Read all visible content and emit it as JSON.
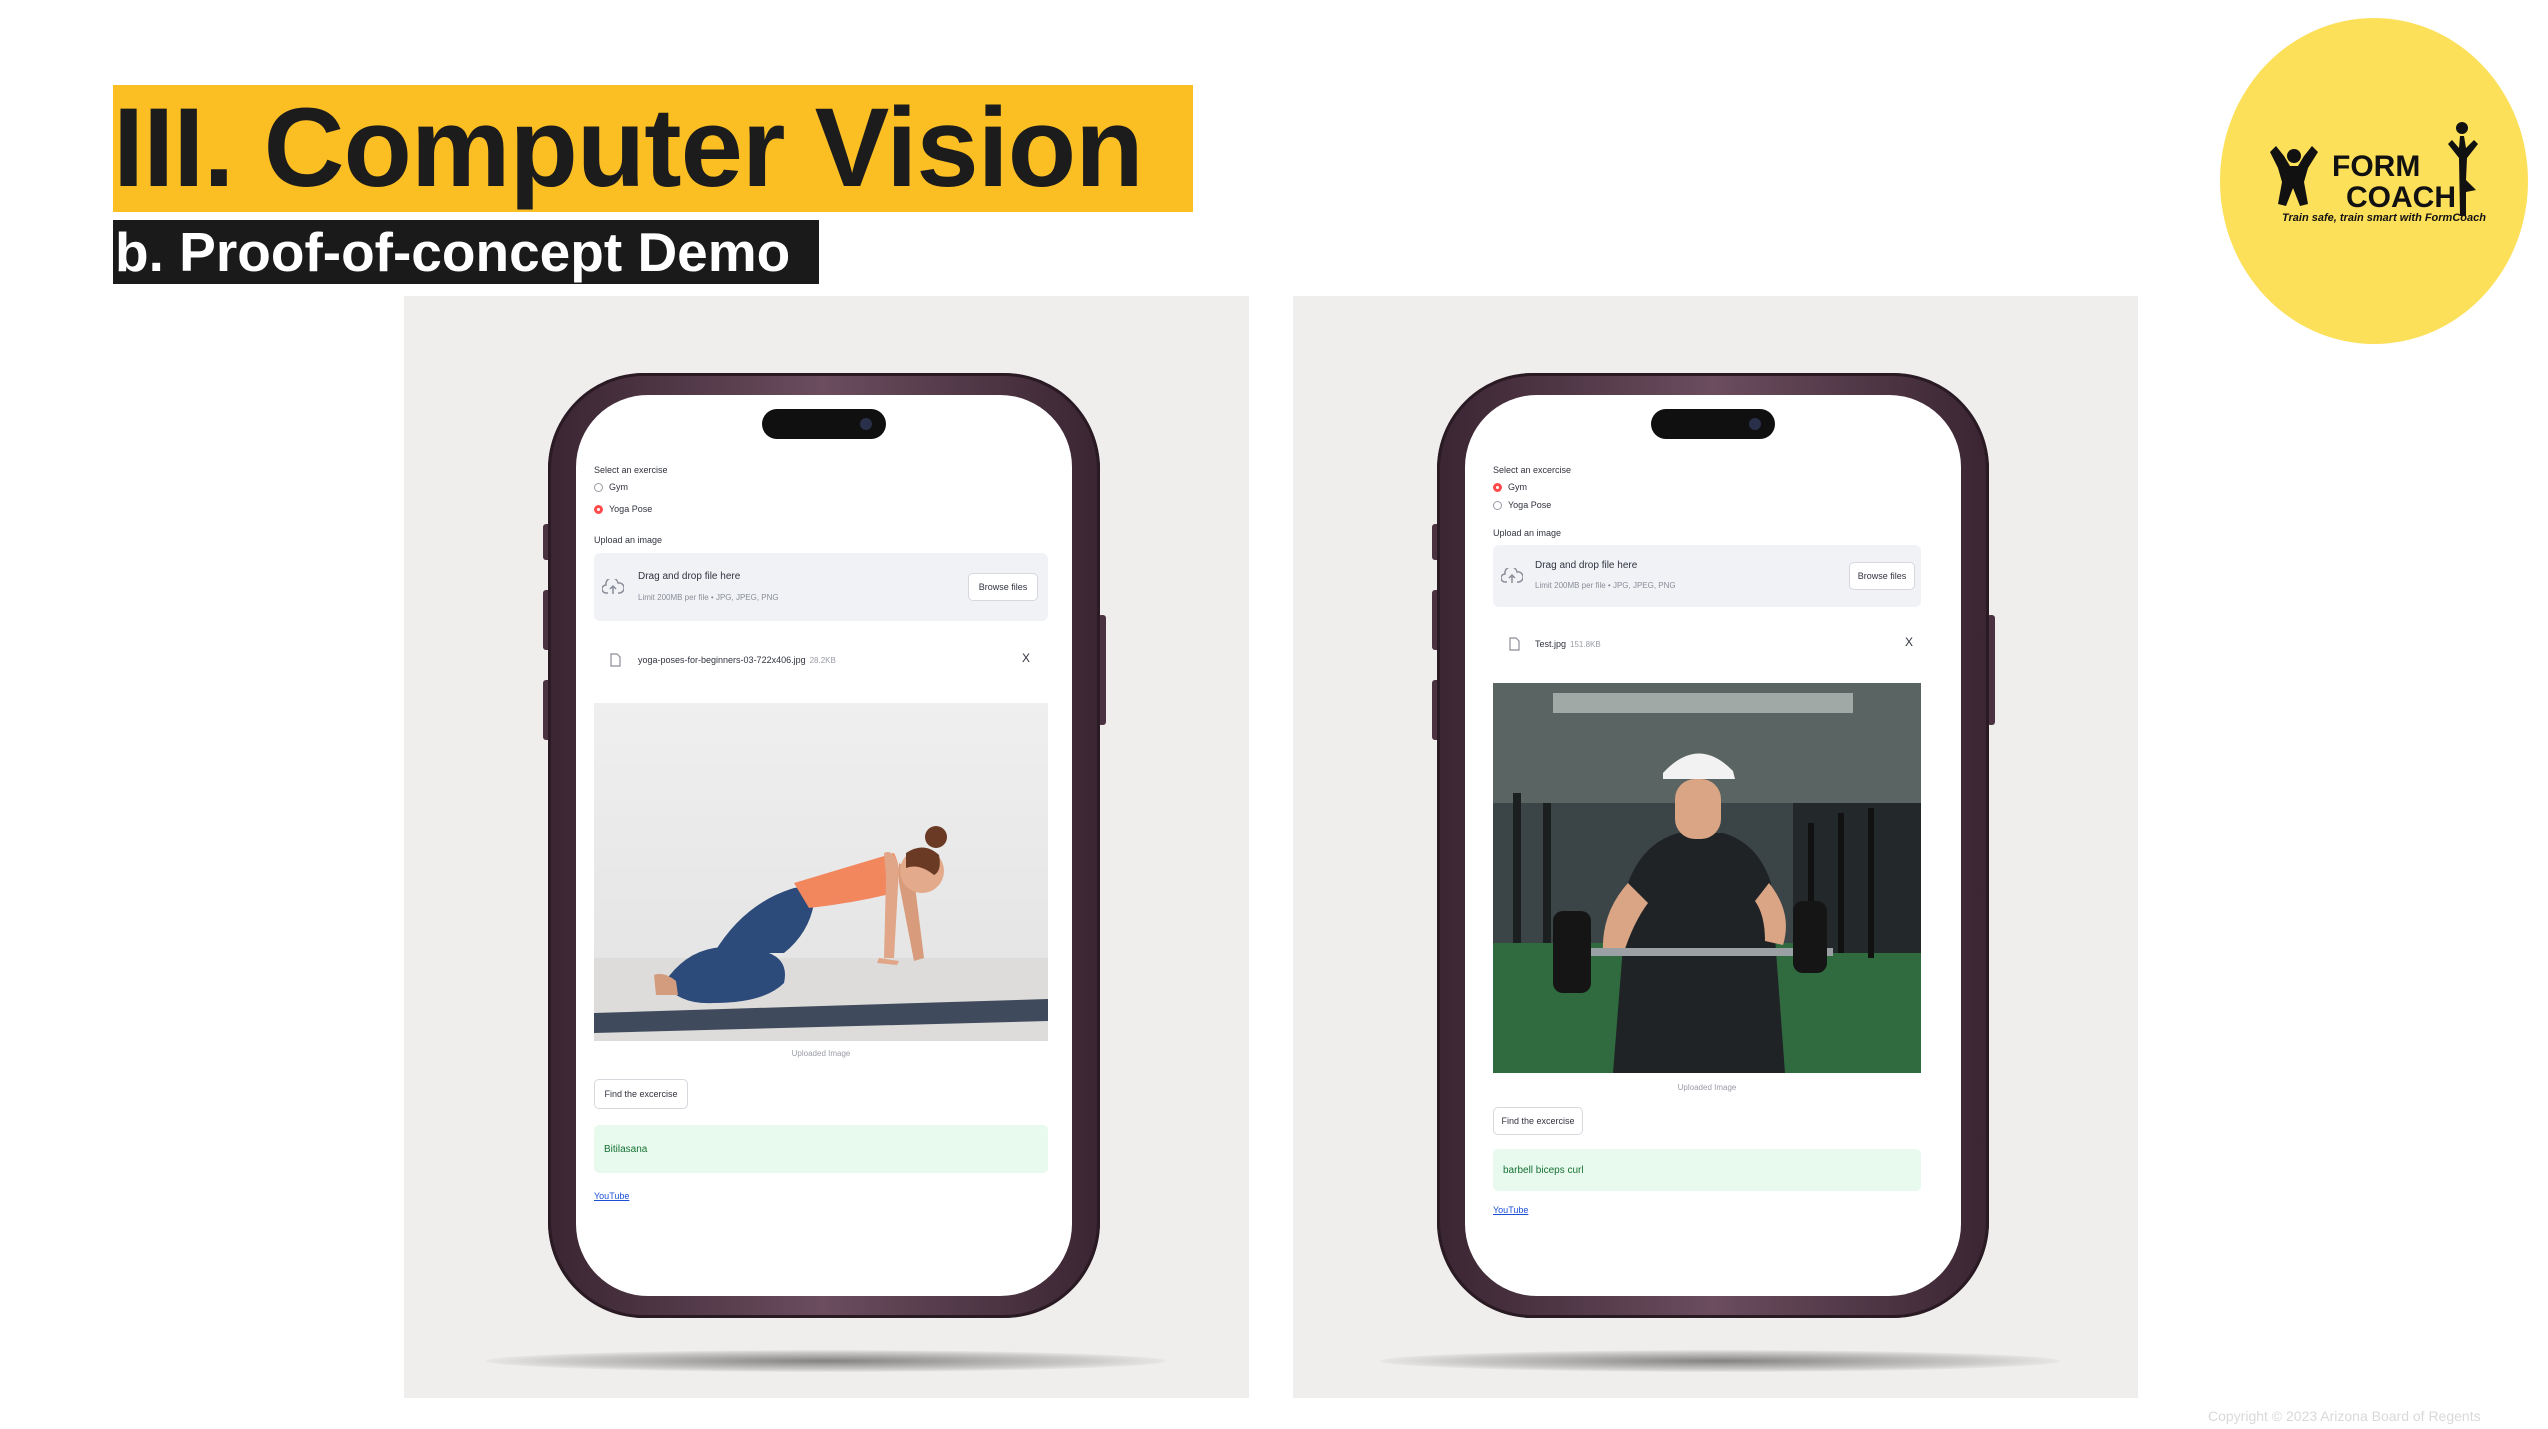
{
  "slide": {
    "title": "III. Computer Vision",
    "subtitle": "b. Proof-of-concept Demo",
    "copyright": "Copyright © 2023 Arizona Board of Regents"
  },
  "logo": {
    "word1": "FORM",
    "word2": "COACH",
    "tagline": "Train safe, train smart with FormCoach",
    "icons": [
      "flexing-athlete-icon",
      "yoga-tree-pose-icon"
    ]
  },
  "colors": {
    "title_banner": "#fbbf24",
    "subtitle_bar": "#1a1a1a",
    "logo_circle": "#fde05a",
    "radio_selected": "#ff4b4b",
    "result_bg": "#e8f9ee",
    "result_text": "#177233"
  },
  "demos": [
    {
      "select_label": "Select an exercise",
      "options": [
        {
          "label": "Gym",
          "selected": false
        },
        {
          "label": "Yoga Pose",
          "selected": true
        }
      ],
      "upload_label": "Upload an image",
      "dropzone_title": "Drag and drop file here",
      "dropzone_limit": "Limit 200MB per file • JPG, JPEG, PNG",
      "browse_label": "Browse files",
      "file_name": "yoga-poses-for-beginners-03-722x406.jpg",
      "file_size": "28.2KB",
      "remove_label": "X",
      "image_caption": "Uploaded Image",
      "find_button": "Find the excercise",
      "result": "Bitilasana",
      "link": "YouTube"
    },
    {
      "select_label": "Select an excercise",
      "options": [
        {
          "label": "Gym",
          "selected": true
        },
        {
          "label": "Yoga Pose",
          "selected": false
        }
      ],
      "upload_label": "Upload an image",
      "dropzone_title": "Drag and drop file here",
      "dropzone_limit": "Limit 200MB per file • JPG, JPEG, PNG",
      "browse_label": "Browse files",
      "file_name": "Test.jpg",
      "file_size": "151.8KB",
      "remove_label": "X",
      "image_caption": "Uploaded Image",
      "find_button": "Find the excercise",
      "result": "barbell biceps curl",
      "link": "YouTube"
    }
  ]
}
